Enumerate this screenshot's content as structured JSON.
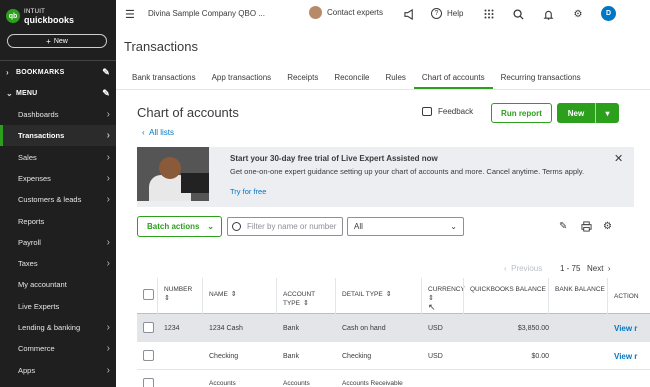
{
  "brand": {
    "logo_letters": "qb",
    "line1": "INTUIT",
    "line2": "quickbooks"
  },
  "sidebar": {
    "new_label": "New",
    "bookmarks_label": "BOOKMARKS",
    "menu_label": "MENU",
    "items": [
      {
        "label": "Dashboards",
        "arrow": true
      },
      {
        "label": "Transactions",
        "arrow": true,
        "active": true
      },
      {
        "label": "Sales",
        "arrow": true
      },
      {
        "label": "Expenses",
        "arrow": true
      },
      {
        "label": "Customers & leads",
        "arrow": true
      },
      {
        "label": "Reports",
        "arrow": false
      },
      {
        "label": "Payroll",
        "arrow": true
      },
      {
        "label": "Taxes",
        "arrow": true
      },
      {
        "label": "My accountant",
        "arrow": false
      },
      {
        "label": "Live Experts",
        "arrow": false
      },
      {
        "label": "Lending & banking",
        "arrow": true
      },
      {
        "label": "Commerce",
        "arrow": true
      },
      {
        "label": "Apps",
        "arrow": true
      }
    ]
  },
  "topbar": {
    "company": "Divina Sample Company QBO ...",
    "contact": "Contact experts",
    "help": "Help",
    "avatar_initial": "D"
  },
  "page": {
    "title": "Transactions",
    "tabs": [
      {
        "label": "Bank transactions"
      },
      {
        "label": "App transactions"
      },
      {
        "label": "Receipts"
      },
      {
        "label": "Reconcile"
      },
      {
        "label": "Rules"
      },
      {
        "label": "Chart of accounts",
        "active": true
      },
      {
        "label": "Recurring transactions"
      }
    ]
  },
  "coa": {
    "title": "Chart of accounts",
    "back_link": "All lists",
    "feedback": "Feedback",
    "run_report": "Run report",
    "new_label": "New"
  },
  "banner": {
    "heading": "Start your 30-day free trial of Live Expert Assisted now",
    "body": "Get one-on-one expert guidance setting up your chart of accounts and more. Cancel anytime. Terms apply.",
    "link": "Try for free"
  },
  "toolbar": {
    "batch_actions": "Batch actions",
    "filter_placeholder": "Filter by name or number",
    "type_select": "All"
  },
  "pager": {
    "previous": "Previous",
    "range": "1 - 75",
    "next": "Next"
  },
  "table": {
    "headers": [
      "NUMBER",
      "NAME",
      "ACCOUNT TYPE",
      "DETAIL TYPE",
      "CURRENCY",
      "QUICKBOOKS BALANCE",
      "BANK BALANCE",
      "ACTION"
    ],
    "rows": [
      {
        "number": "1234",
        "name": "1234 Cash",
        "type": "Bank",
        "detail": "Cash on hand",
        "currency": "USD",
        "qb_balance": "$3,850.00",
        "bank_balance": "",
        "action": "View r"
      },
      {
        "number": "",
        "name": "Checking",
        "type": "Bank",
        "detail": "Checking",
        "currency": "USD",
        "qb_balance": "$0.00",
        "bank_balance": "",
        "action": "View r"
      },
      {
        "number": "",
        "name": "Accounts",
        "type": "Accounts",
        "detail": "Accounts Receivable",
        "currency": "",
        "qb_balance": "",
        "bank_balance": "",
        "action": ""
      }
    ]
  },
  "colors": {
    "accent": "#2ca01c",
    "link": "#0077c5",
    "sidebar": "#1f1f1f"
  }
}
